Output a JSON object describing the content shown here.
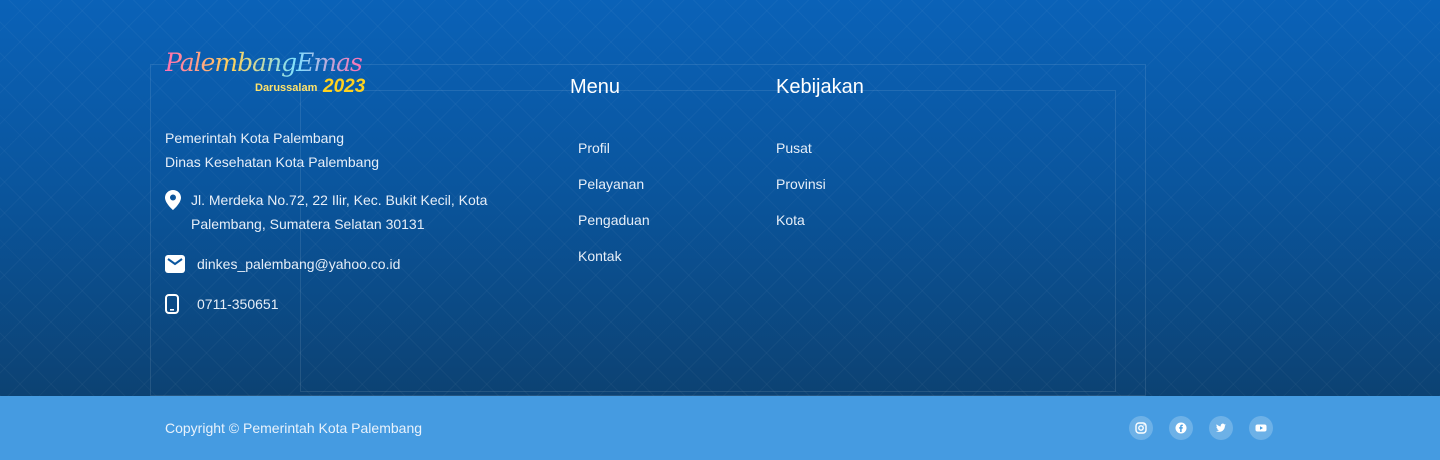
{
  "logo": {
    "script_text": "PalembangEmas",
    "sub_text": "Darussalam",
    "year_text": "2023"
  },
  "org": {
    "line1": "Pemerintah Kota Palembang",
    "line2": "Dinas Kesehatan Kota Palembang"
  },
  "contact": {
    "address": "Jl. Merdeka No.72, 22 Ilir, Kec. Bukit Kecil, Kota Palembang, Sumatera Selatan 30131",
    "email": "dinkes_palembang@yahoo.co.id",
    "phone": "0711-350651",
    "address_icon": "map-pin-icon",
    "email_icon": "mail-icon",
    "phone_icon": "phone-icon"
  },
  "menu": {
    "title": "Menu",
    "items": [
      "Profil",
      "Pelayanan",
      "Pengaduan",
      "Kontak"
    ]
  },
  "kebijakan": {
    "title": "Kebijakan",
    "items": [
      "Pusat",
      "Provinsi",
      "Kota"
    ]
  },
  "footer": {
    "copyright": "Copyright © Pemerintah Kota Palembang",
    "socials": [
      "instagram-icon",
      "facebook-icon",
      "twitter-icon",
      "youtube-icon"
    ]
  },
  "colors": {
    "top_bg": "#0a62b8",
    "bottom_bg": "#459be1",
    "logo_year": "#ffd21f"
  }
}
